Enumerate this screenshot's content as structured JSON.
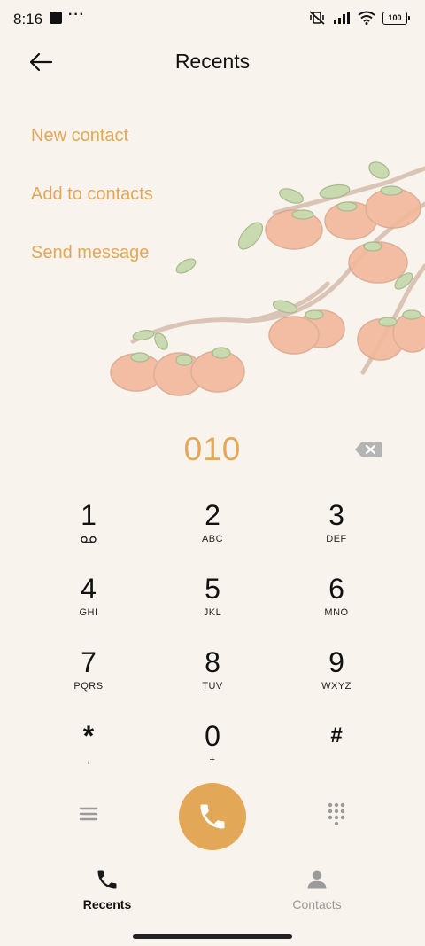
{
  "status_bar": {
    "time": "8:16",
    "dots": "···",
    "battery": "100",
    "icons": [
      "app-square-icon",
      "muted-vibrate-icon",
      "cellular-signal-icon",
      "wifi-icon",
      "battery-icon"
    ]
  },
  "header": {
    "title": "Recents",
    "back_icon": "back-arrow-icon"
  },
  "actions": [
    {
      "label": "New contact"
    },
    {
      "label": "Add to contacts"
    },
    {
      "label": "Send message"
    }
  ],
  "dialer": {
    "number": "010",
    "backspace_icon": "backspace-icon"
  },
  "keypad": [
    {
      "digit": "1",
      "letters": "",
      "icon": "voicemail-icon"
    },
    {
      "digit": "2",
      "letters": "ABC"
    },
    {
      "digit": "3",
      "letters": "DEF"
    },
    {
      "digit": "4",
      "letters": "GHI"
    },
    {
      "digit": "5",
      "letters": "JKL"
    },
    {
      "digit": "6",
      "letters": "MNO"
    },
    {
      "digit": "7",
      "letters": "PQRS"
    },
    {
      "digit": "8",
      "letters": "TUV"
    },
    {
      "digit": "9",
      "letters": "WXYZ"
    },
    {
      "digit": "*",
      "letters": ","
    },
    {
      "digit": "0",
      "letters": "+"
    },
    {
      "digit": "#",
      "letters": ""
    }
  ],
  "bottom_actions": {
    "menu_icon": "menu-icon",
    "call_icon": "phone-icon",
    "dialpad_icon": "dialpad-icon"
  },
  "nav": {
    "tabs": [
      {
        "label": "Recents",
        "icon": "phone-icon",
        "active": true
      },
      {
        "label": "Contacts",
        "icon": "person-icon",
        "active": false
      }
    ]
  },
  "colors": {
    "accent": "#e3a857",
    "background": "#f8f3ec",
    "inactive": "#9a9a9a"
  }
}
